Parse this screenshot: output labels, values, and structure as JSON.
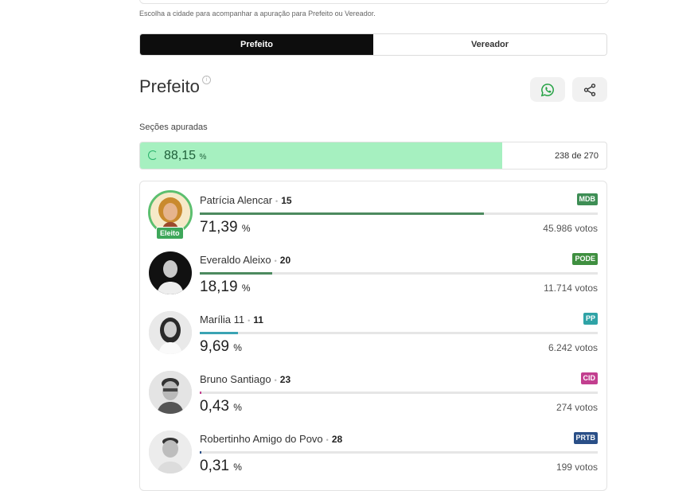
{
  "hint_text": "Escolha a cidade para acompanhar a apuração para Prefeito ou Vereador.",
  "tabs": [
    {
      "label": "Prefeito",
      "active": true
    },
    {
      "label": "Vereador",
      "active": false
    }
  ],
  "heading": "Prefeito",
  "icons": {
    "info": "info-icon",
    "whatsapp": "whatsapp-icon",
    "share": "share-icon"
  },
  "sections": {
    "label": "Seções apuradas",
    "percent": "88,15",
    "percent_unit": "%",
    "fraction": 0.8815,
    "count": "238 de 270"
  },
  "elected_label": "Eleito",
  "candidates": [
    {
      "name": "Patrícia Alencar",
      "number": "15",
      "party": "MDB",
      "party_color": "#3e8e55",
      "percent": "71,39",
      "percent_value": 71.39,
      "bar_color": "#4c8a5f",
      "votes": "45.986 votos",
      "elected": true
    },
    {
      "name": "Everaldo Aleixo",
      "number": "20",
      "party": "PODE",
      "party_color": "#3f8f40",
      "percent": "18,19",
      "percent_value": 18.19,
      "bar_color": "#4c8a5f",
      "votes": "11.714 votos",
      "elected": false
    },
    {
      "name": "Marília 11",
      "number": "11",
      "party": "PP",
      "party_color": "#2fa3a6",
      "percent": "9,69",
      "percent_value": 9.69,
      "bar_color": "#3aa3b3",
      "votes": "6.242 votos",
      "elected": false
    },
    {
      "name": "Bruno Santiago",
      "number": "23",
      "party": "CID",
      "party_color": "#c23f8f",
      "percent": "0,43",
      "percent_value": 0.43,
      "bar_color": "#c23f8f",
      "votes": "274 votos",
      "elected": false
    },
    {
      "name": "Robertinho Amigo do Povo",
      "number": "28",
      "party": "PRTB",
      "party_color": "#2a4f87",
      "percent": "0,31",
      "percent_value": 0.31,
      "bar_color": "#2a4f87",
      "votes": "199 votos",
      "elected": false
    }
  ],
  "percent_unit": "%"
}
